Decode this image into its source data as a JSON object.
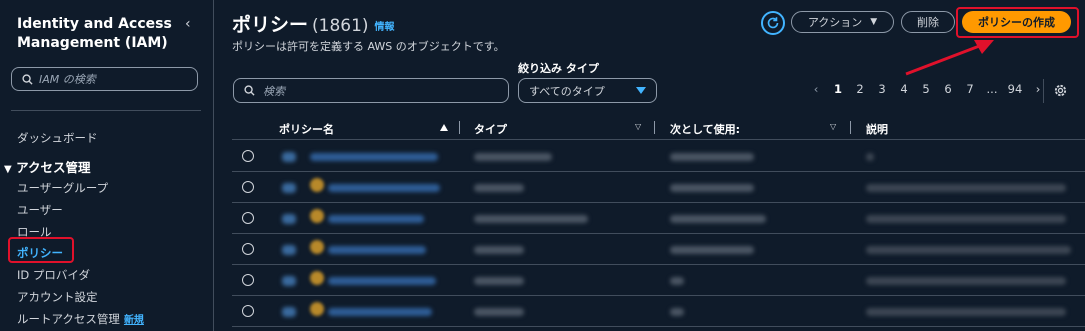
{
  "sidebar": {
    "title": "Identity and Access Management (IAM)",
    "search_placeholder": "IAM の検索",
    "dashboard": "ダッシュボード",
    "section": "アクセス管理",
    "items": [
      {
        "label": "ユーザーグループ"
      },
      {
        "label": "ユーザー"
      },
      {
        "label": "ロール"
      },
      {
        "label": "ポリシー"
      },
      {
        "label": "ID プロバイダ"
      },
      {
        "label": "アカウント設定"
      },
      {
        "label": "ルートアクセス管理",
        "badge": "新規"
      }
    ]
  },
  "header": {
    "title": "ポリシー",
    "count": "(1861)",
    "info": "情報",
    "subtitle": "ポリシーは許可を定義する AWS のオブジェクトです。",
    "action_label": "アクション",
    "delete_label": "削除",
    "create_label": "ポリシーの作成"
  },
  "filters": {
    "search_placeholder": "検索",
    "type_label": "絞り込み タイプ",
    "type_value": "すべてのタイプ"
  },
  "pagination": {
    "pages": [
      "1",
      "2",
      "3",
      "4",
      "5",
      "6",
      "7"
    ],
    "ellipsis": "...",
    "last": "94",
    "current": "1"
  },
  "table": {
    "columns": [
      "ポリシー名",
      "タイプ",
      "次として使用:",
      "説明"
    ],
    "rows": [
      {
        "aws_managed": false
      },
      {
        "aws_managed": true
      },
      {
        "aws_managed": true
      },
      {
        "aws_managed": true
      },
      {
        "aws_managed": true
      },
      {
        "aws_managed": true
      }
    ]
  },
  "colors": {
    "background": "#0f1b2a",
    "accent": "#42b4ff",
    "primary_button": "#ff9900",
    "highlight": "#e0112b"
  }
}
